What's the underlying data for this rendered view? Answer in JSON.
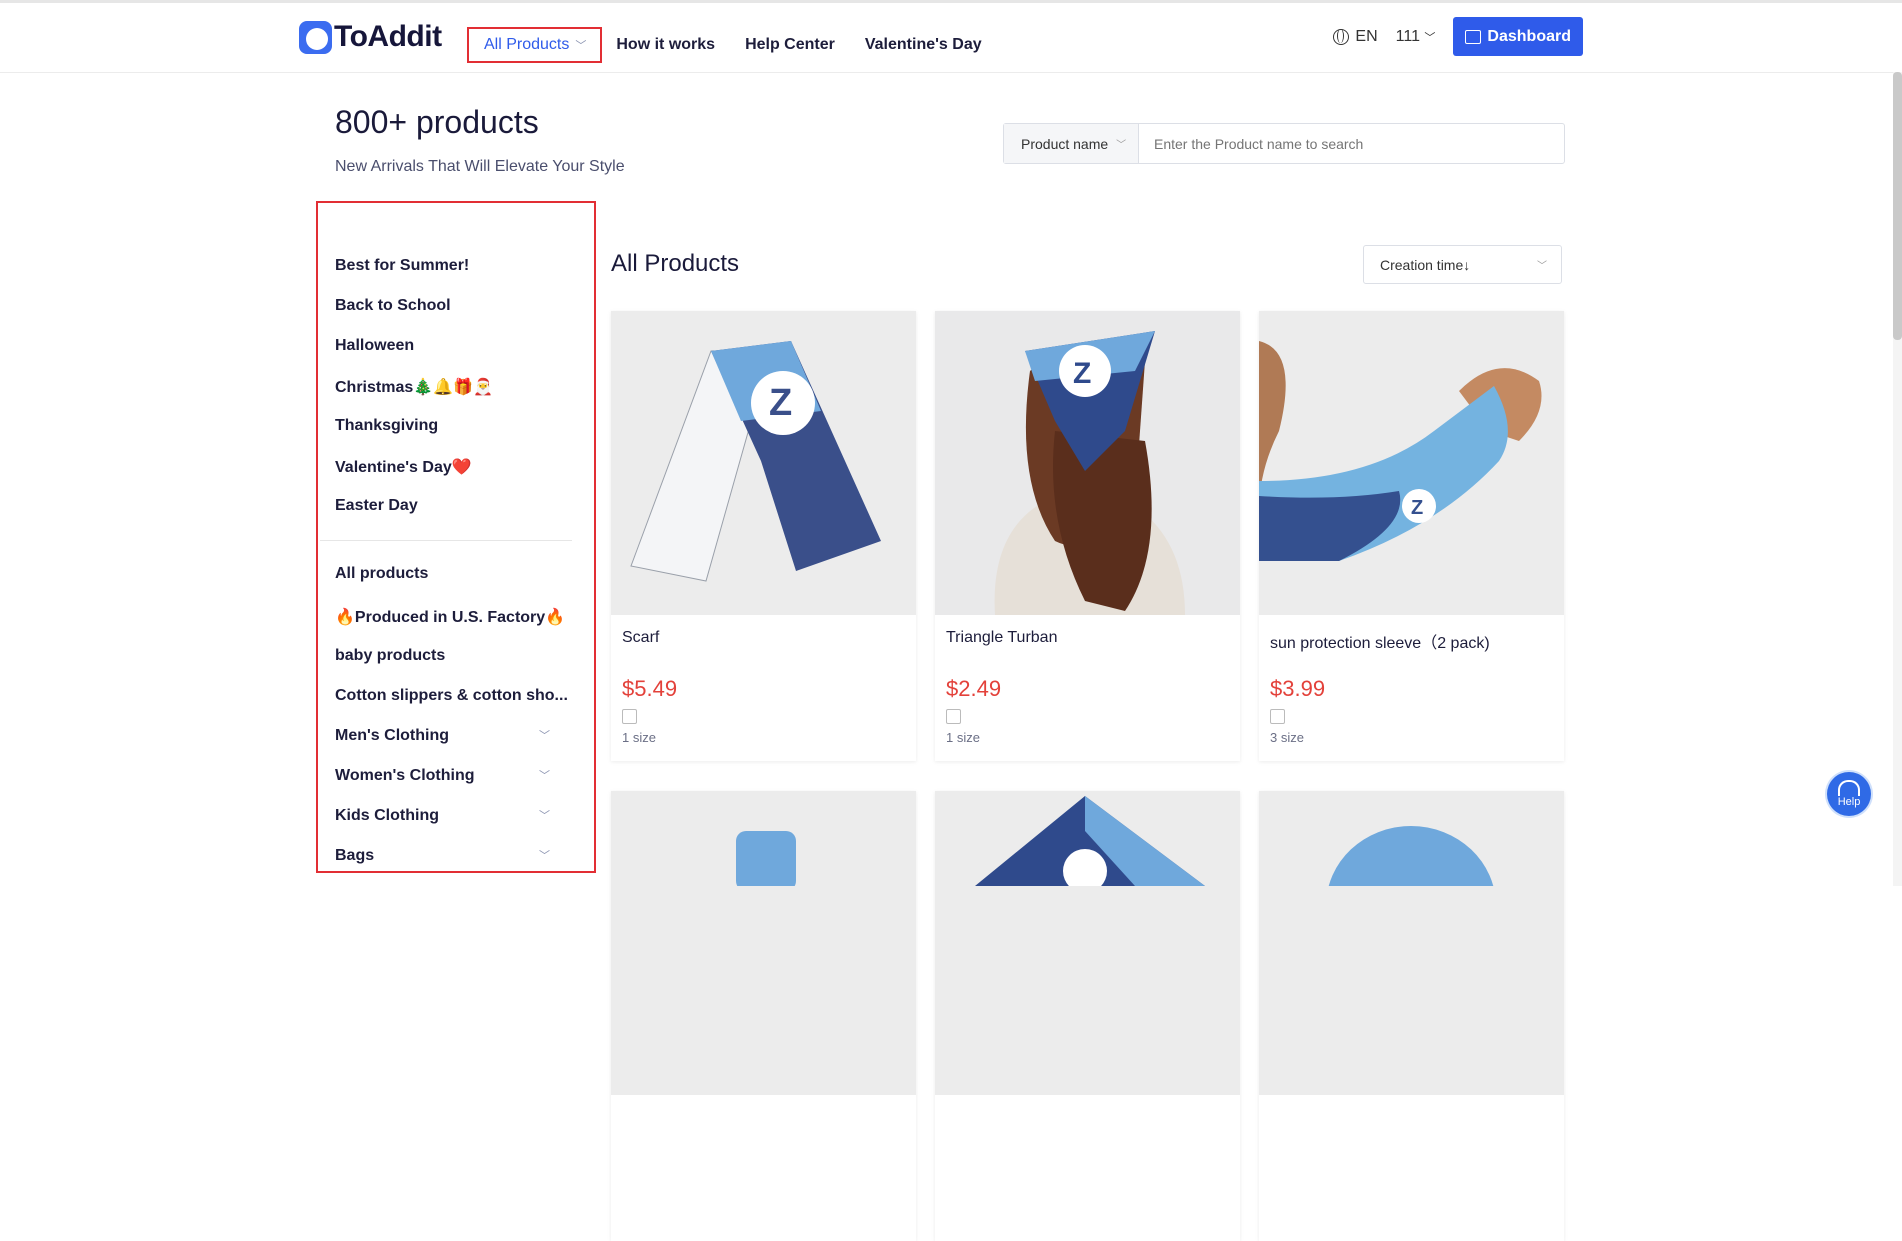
{
  "header": {
    "brand": "ToAddit",
    "nav": [
      {
        "label": "All Products",
        "active": true
      },
      {
        "label": "How it works"
      },
      {
        "label": "Help Center"
      },
      {
        "label": "Valentine's Day"
      }
    ],
    "language": "EN",
    "user": "111",
    "dashboard_label": "Dashboard",
    "accent_color": "#2f5bea"
  },
  "page": {
    "title": "800+ products",
    "subtitle": "New Arrivals That Will Elevate Your Style"
  },
  "search": {
    "type_label": "Product name",
    "placeholder": "Enter the Product name to search"
  },
  "sidebar": {
    "seasonal": [
      "Best for Summer!",
      "Back to School",
      "Halloween",
      "Christmas🎄🔔🎁🎅",
      "Thanksgiving",
      "Valentine's Day❤️",
      "Easter Day"
    ],
    "categories": [
      {
        "label": "All products"
      },
      {
        "label": "🔥Produced in U.S. Factory🔥"
      },
      {
        "label": "baby products"
      },
      {
        "label": "Cotton slippers & cotton sho..."
      },
      {
        "label": "Men's Clothing",
        "expandable": true
      },
      {
        "label": "Women's Clothing",
        "expandable": true
      },
      {
        "label": "Kids Clothing",
        "expandable": true
      },
      {
        "label": "Bags",
        "expandable": true
      }
    ]
  },
  "content": {
    "title": "All Products",
    "sort_label": "Creation time↓",
    "products": [
      {
        "name": "Scarf",
        "price": "$5.49",
        "sizes": "1 size"
      },
      {
        "name": "Triangle Turban",
        "price": "$2.49",
        "sizes": "1 size"
      },
      {
        "name": "sun protection sleeve（2 pack)",
        "price": "$3.99",
        "sizes": "3 size"
      }
    ]
  },
  "help_label": "Help",
  "icons": {
    "globe": "globe-icon",
    "chevron": "chevron-down-icon",
    "dashboard": "chart-icon",
    "help": "headset-icon"
  }
}
